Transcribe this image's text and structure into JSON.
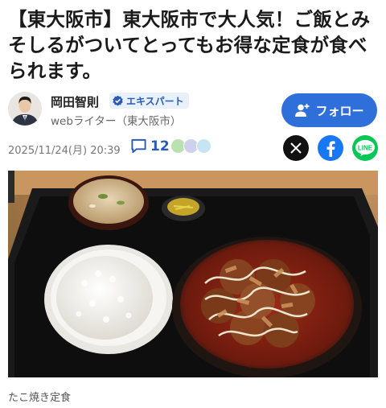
{
  "headline": "【東大阪市】東大阪市で大人気！ご飯とみそしるがついてとってもお得な定食が食べられます。",
  "author": {
    "name": "岡田智則",
    "badge": "エキスパート",
    "role": "webライター（東大阪市）"
  },
  "follow_button": {
    "label": "フォロー",
    "icon": "person-plus-icon"
  },
  "meta": {
    "date": "2025/11/24(月) 20:39",
    "comment_count": "12"
  },
  "share": [
    {
      "name": "X",
      "icon": "x-icon"
    },
    {
      "name": "Facebook",
      "icon": "facebook-icon"
    },
    {
      "name": "LINE",
      "icon": "line-icon",
      "label": "LINE"
    }
  ],
  "photo": {
    "caption": "たこ焼き定食"
  },
  "colors": {
    "accent": "#2f6fd9",
    "badge_bg": "#e8f0fb",
    "facebook": "#1877f2",
    "line": "#06c755"
  }
}
